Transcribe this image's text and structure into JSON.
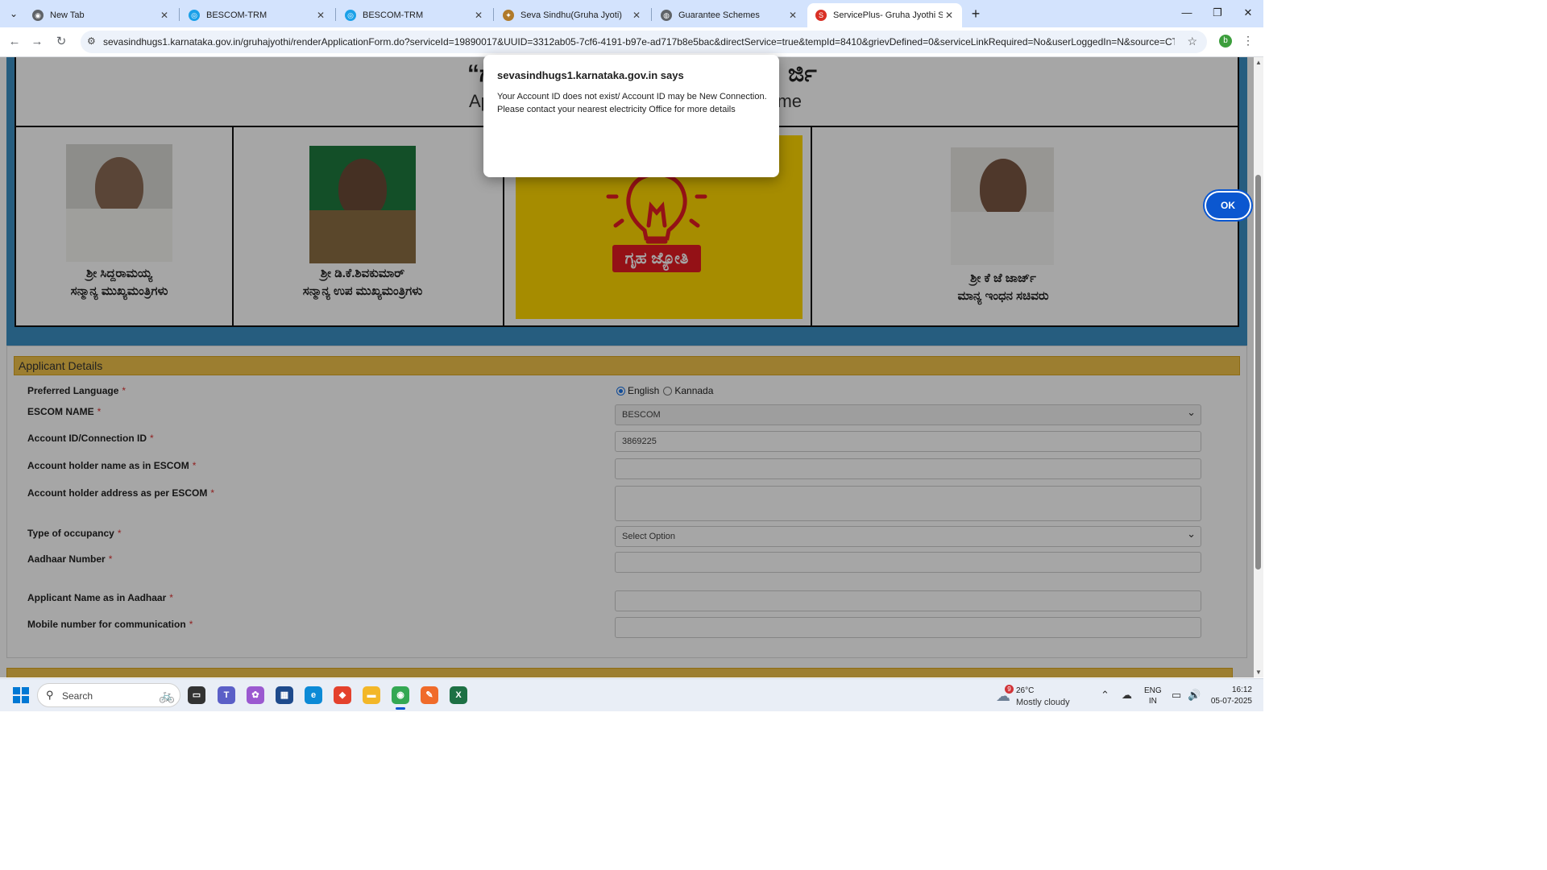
{
  "browser": {
    "tabs": [
      {
        "title": "New Tab",
        "icon": "chrome-icon",
        "color": "#5f6368"
      },
      {
        "title": "BESCOM-TRM",
        "icon": "bescom-icon",
        "color": "#1aa0e8"
      },
      {
        "title": "BESCOM-TRM",
        "icon": "bescom-icon",
        "color": "#1aa0e8"
      },
      {
        "title": "Seva Sindhu(Gruha Jyoti)",
        "icon": "emblem-icon",
        "color": "#b07a2a"
      },
      {
        "title": "Guarantee Schemes",
        "icon": "globe-icon",
        "color": "#5f6368"
      },
      {
        "title": "ServicePlus- Gruha Jyothi Scher",
        "icon": "serviceplus-icon",
        "color": "#d93025"
      }
    ],
    "active_tab": 5,
    "url": "sevasindhugs1.karnataka.gov.in/gruhajyothi/renderApplicationForm.do?serviceId=19890017&UUID=3312ab05-7cf6-4191-b97e-ad717b8e5bac&directService=true&tempId=8410&grievDefined=0&serviceLinkRequired=No&userLoggedIn=N&source=CTZN&OW...",
    "profile_initial": "b"
  },
  "banner": {
    "title_kannada_left": "“ಗ",
    "title_kannada_right": "ರ್ಜಿ",
    "title_english_left": "Ap",
    "title_english_right": "heme",
    "people": [
      {
        "name": "ಶ್ರೀ ಸಿದ್ದರಾಮಯ್ಯ",
        "role": "ಸನ್ಮಾನ್ಯ ಮುಖ್ಯಮಂತ್ರಿಗಳು"
      },
      {
        "name": "ಶ್ರೀ ಡಿ.ಕೆ.ಶಿವಕುಮಾರ್",
        "role": "ಸನ್ಮಾನ್ಯ ಉಪ ಮುಖ್ಯಮಂತ್ರಿಗಳು"
      },
      {
        "name": "ಶ್ರೀ ಕೆ ಜೆ ಜಾರ್ಜ್",
        "role": "ಮಾನ್ಯ ಇಂಧನ ಸಚಿವರು"
      }
    ],
    "logo_text": "ಗೃಹ ಜ್ಯೋತಿ"
  },
  "form": {
    "section_title": "Applicant Details",
    "fields": {
      "preferred_language": {
        "label": "Preferred Language",
        "options": [
          "English",
          "Kannada"
        ],
        "selected": "English"
      },
      "escom_name": {
        "label": "ESCOM NAME",
        "value": "BESCOM"
      },
      "account_id": {
        "label": "Account ID/Connection ID",
        "value": "3869225"
      },
      "account_holder_name": {
        "label": "Account holder name as in ESCOM",
        "value": ""
      },
      "account_holder_address": {
        "label": "Account holder address as per ESCOM",
        "value": ""
      },
      "occupancy": {
        "label": "Type of occupancy",
        "value": "Select Option"
      },
      "aadhaar": {
        "label": "Aadhaar Number",
        "value": ""
      },
      "applicant_name": {
        "label": "Applicant Name as in Aadhaar",
        "value": ""
      },
      "mobile": {
        "label": "Mobile number for communication",
        "value": ""
      }
    },
    "required_mark": "*"
  },
  "dialog": {
    "title": "sevasindhugs1.karnataka.gov.in says",
    "message": "Your Account ID does not exist/ Account ID may be New Connection. Please contact your nearest electricity Office for more details",
    "ok_label": "OK"
  },
  "taskbar": {
    "search_placeholder": "Search",
    "weather_badge": "9",
    "temperature": "26°C",
    "condition": "Mostly cloudy",
    "lang_line1": "ENG",
    "lang_line2": "IN",
    "time": "16:12",
    "date": "05-07-2025"
  }
}
